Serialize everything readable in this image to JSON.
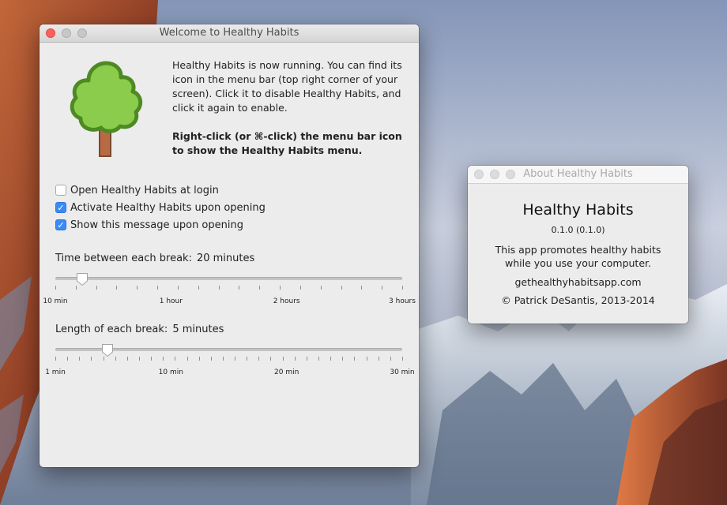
{
  "welcome_window": {
    "title": "Welcome to Healthy Habits",
    "intro_text": "Healthy Habits is now running. You can find its icon in the menu bar (top right corner of your screen). Click it to disable Healthy Habits, and click it again to enable.",
    "menu_hint": "Right-click (or ⌘-click) the menu bar icon to show the Healthy Habits menu.",
    "checkboxes": [
      {
        "label": "Open Healthy Habits at login",
        "checked": false
      },
      {
        "label": "Activate Healthy Habits upon opening",
        "checked": true
      },
      {
        "label": "Show this message upon opening",
        "checked": true
      }
    ],
    "break_interval": {
      "label": "Time between each break:",
      "value": "20 minutes",
      "position_fraction": 0.078,
      "tick_labels": [
        "10 min",
        "1 hour",
        "2 hours",
        "3 hours"
      ],
      "tick_count": 18
    },
    "break_length": {
      "label": "Length of each break:",
      "value": "5 minutes",
      "position_fraction": 0.151,
      "tick_labels": [
        "1 min",
        "10 min",
        "20 min",
        "30 min"
      ],
      "tick_count": 30
    }
  },
  "about_window": {
    "title": "About Healthy Habits",
    "app_name": "Healthy Habits",
    "version": "0.1.0 (0.1.0)",
    "description_line1": "This app promotes healthy habits",
    "description_line2": "while you use your computer.",
    "website": "gethealthyhabitsapp.com",
    "copyright": "© Patrick DeSantis, 2013-2014"
  },
  "icons": {
    "app": "tree-icon",
    "check": "checkmark-icon"
  },
  "colors": {
    "close_button": "#fc605c",
    "checkbox_accent": "#3b8bf5",
    "tree_leaves": "#8ccc4c",
    "tree_trunk": "#b86a45"
  }
}
